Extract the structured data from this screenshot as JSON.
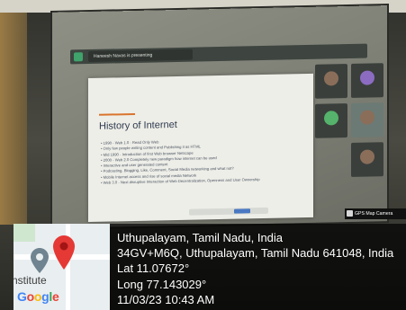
{
  "meeting": {
    "presenting_text": "Haneesh Navas is presenting"
  },
  "slide": {
    "title": "History of Internet",
    "bullets": [
      "1990 - Web 1.0 - Read Only Web",
      "Only few people writing content and Publishing it as HTML",
      "Mid 1990 - Introduction of first Web browser Netscape",
      "2000 - Web 2.0 Completely new paradigm how internet can be used",
      "Interactive and user generated content",
      "Podcasting, Blogging, Like, Comment, Social Media networking and what not?",
      "Mobile Internet access and rise of social media Network",
      "Web 3.0 - Next disruptive Interaction of Web Decentralization, Openness and User Ownership"
    ]
  },
  "participants": [
    {
      "icon": "person-icon"
    },
    {
      "icon": "person-icon"
    },
    {
      "icon": "person-icon"
    },
    {
      "icon": "person-icon"
    },
    {
      "icon": "person-icon"
    }
  ],
  "gps_badge": {
    "label": "GPS Map Camera"
  },
  "map": {
    "place_label": "nstitute",
    "logo_text": "Google"
  },
  "location": {
    "place": "Uthupalayam, Tamil Nadu, India",
    "address": "34GV+M6Q, Uthupalayam, Tamil Nadu 641048, India",
    "lat": "Lat 11.07672°",
    "long": "Long 77.143029°",
    "datetime": "11/03/23 10:43 AM"
  },
  "colors": {
    "pin_red": "#e53935",
    "overlay": "#000000",
    "slide_accent": "#d9742c"
  }
}
